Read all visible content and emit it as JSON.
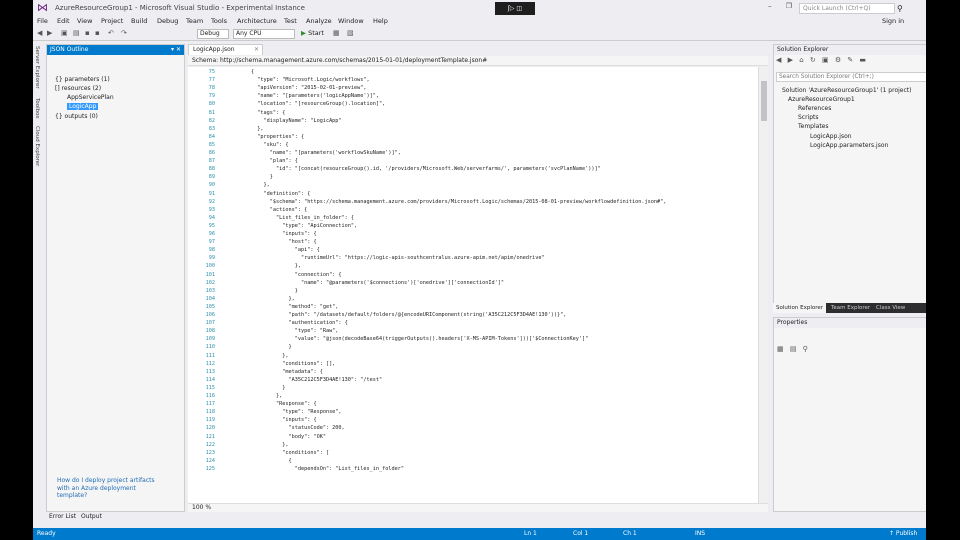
{
  "title": {
    "text": "AzureResourceGroup1 - Microsoft Visual Studio - Experimental Instance",
    "notification": "ʃ▷ ◫",
    "quick_launch_placeholder": "Quick Launch (Ctrl+Q)",
    "window_buttons": "– ❐ ✕"
  },
  "menu": [
    "File",
    "Edit",
    "View",
    "Project",
    "Build",
    "Debug",
    "Team",
    "Tools",
    "Architecture",
    "Test",
    "Analyze",
    "Window",
    "Help"
  ],
  "signin": "Sign in",
  "toolbar": {
    "config": "Debug",
    "platform": "Any CPU",
    "start": "Start"
  },
  "left_strip": [
    "Server Explorer",
    "Toolbox",
    "Cloud Explorer"
  ],
  "json_outline": {
    "title": "JSON Outline",
    "controls": "▾ ✕",
    "tree": [
      {
        "label": "{} parameters (1)",
        "indent": 1,
        "selected": false
      },
      {
        "label": "[] resources (2)",
        "indent": 1,
        "selected": false
      },
      {
        "label": "AppServicePlan",
        "indent": 2,
        "selected": false
      },
      {
        "label": "LogicApp",
        "indent": 2,
        "selected": true
      },
      {
        "label": "{} outputs (0)",
        "indent": 1,
        "selected": false
      }
    ],
    "help": "How do I deploy project artifacts with an Azure deployment template?"
  },
  "editor": {
    "tab": "LogicApp.json",
    "schema": "Schema: http://schema.management.azure.com/schemas/2015-01-01/deploymentTemplate.json#",
    "zoom": "100 %",
    "lines": [
      {
        "n": "75",
        "t": "        {"
      },
      {
        "n": "77",
        "t": "          \"type\": \"Microsoft.Logic/workflows\","
      },
      {
        "n": "78",
        "t": "          \"apiVersion\": \"2015-02-01-preview\","
      },
      {
        "n": "79",
        "t": "          \"name\": \"[parameters('logicAppName')]\","
      },
      {
        "n": "80",
        "t": "          \"location\": \"[resourceGroup().location]\","
      },
      {
        "n": "81",
        "t": "          \"tags\": {"
      },
      {
        "n": "82",
        "t": "            \"displayName\": \"LogicApp\""
      },
      {
        "n": "83",
        "t": "          },"
      },
      {
        "n": "84",
        "t": "          \"properties\": {"
      },
      {
        "n": "85",
        "t": "            \"sku\": {"
      },
      {
        "n": "86",
        "t": "              \"name\": \"[parameters('workflowSkuName')]\","
      },
      {
        "n": "87",
        "t": "              \"plan\": {"
      },
      {
        "n": "88",
        "t": "                \"id\": \"[concat(resourceGroup().id, '/providers/Microsoft.Web/serverfarms/', parameters('svcPlanName'))]\""
      },
      {
        "n": "89",
        "t": "              }"
      },
      {
        "n": "90",
        "t": "            },"
      },
      {
        "n": "91",
        "t": "            \"definition\": {"
      },
      {
        "n": "92",
        "t": "              \"$schema\": \"https://schema.management.azure.com/providers/Microsoft.Logic/schemas/2015-08-01-preview/workflowdefinition.json#\","
      },
      {
        "n": "93",
        "t": "              \"actions\": {"
      },
      {
        "n": "94",
        "t": "                \"List_files_in_folder\": {"
      },
      {
        "n": "95",
        "t": "                  \"type\": \"ApiConnection\","
      },
      {
        "n": "96",
        "t": "                  \"inputs\": {"
      },
      {
        "n": "97",
        "t": "                    \"host\": {"
      },
      {
        "n": "98",
        "t": "                      \"api\": {"
      },
      {
        "n": "99",
        "t": "                        \"runtimeUrl\": \"https://logic-apis-southcentralus.azure-apim.net/apim/onedrive\""
      },
      {
        "n": "100",
        "t": "                      },"
      },
      {
        "n": "101",
        "t": "                      \"connection\": {"
      },
      {
        "n": "102",
        "t": "                        \"name\": \"@parameters('$connections')['onedrive']['connectionId']\""
      },
      {
        "n": "103",
        "t": "                      }"
      },
      {
        "n": "104",
        "t": "                    },"
      },
      {
        "n": "105",
        "t": "                    \"method\": \"get\","
      },
      {
        "n": "106",
        "t": "                    \"path\": \"/datasets/default/folders/@{encodeURIComponent(string('A35C212C5F3D4AE!130'))}\","
      },
      {
        "n": "107",
        "t": "                    \"authentication\": {"
      },
      {
        "n": "108",
        "t": "                      \"type\": \"Raw\","
      },
      {
        "n": "109",
        "t": "                      \"value\": \"@json(decodeBase64(triggerOutputs().headers['X-MS-APIM-Tokens']))['$ConnectionKey']\""
      },
      {
        "n": "110",
        "t": "                    }"
      },
      {
        "n": "111",
        "t": "                  },"
      },
      {
        "n": "112",
        "t": "                  \"conditions\": [],"
      },
      {
        "n": "113",
        "t": "                  \"metadata\": {"
      },
      {
        "n": "114",
        "t": "                    \"A35C212C5F3D4AE!130\": \"/test\""
      },
      {
        "n": "115",
        "t": "                  }"
      },
      {
        "n": "116",
        "t": "                },"
      },
      {
        "n": "117",
        "t": "                \"Response\": {"
      },
      {
        "n": "118",
        "t": "                  \"type\": \"Response\","
      },
      {
        "n": "119",
        "t": "                  \"inputs\": {"
      },
      {
        "n": "120",
        "t": "                    \"statusCode\": 200,"
      },
      {
        "n": "121",
        "t": "                    \"body\": \"OK\""
      },
      {
        "n": "122",
        "t": "                  },"
      },
      {
        "n": "123",
        "t": "                  \"conditions\": ["
      },
      {
        "n": "124",
        "t": "                    {"
      },
      {
        "n": "125",
        "t": "                      \"dependsOn\": \"List_files_in_folder\""
      }
    ]
  },
  "solution_explorer": {
    "title": "Solution Explorer",
    "controls": "▾ ⊓ ✕",
    "search_placeholder": "Search Solution Explorer (Ctrl+;)",
    "tree": [
      {
        "label": "Solution 'AzureResourceGroup1' (1 project)",
        "indent": 0
      },
      {
        "label": "AzureResourceGroup1",
        "indent": 1
      },
      {
        "label": "References",
        "indent": 2
      },
      {
        "label": "Scripts",
        "indent": 2
      },
      {
        "label": "Templates",
        "indent": 2
      },
      {
        "label": "LogicApp.json",
        "indent": 3
      },
      {
        "label": "LogicApp.parameters.json",
        "indent": 3
      }
    ],
    "tabs": [
      "Solution Explorer",
      "Team Explorer",
      "Class View"
    ]
  },
  "properties": {
    "title": "Properties",
    "controls": "▾ ⊓ ✕"
  },
  "bottom_tabs": [
    "Error List",
    "Output"
  ],
  "status": {
    "ready": "Ready",
    "ln": "Ln 1",
    "col": "Col 1",
    "ch": "Ch 1",
    "ins": "INS",
    "publish": "↑ Publish"
  }
}
